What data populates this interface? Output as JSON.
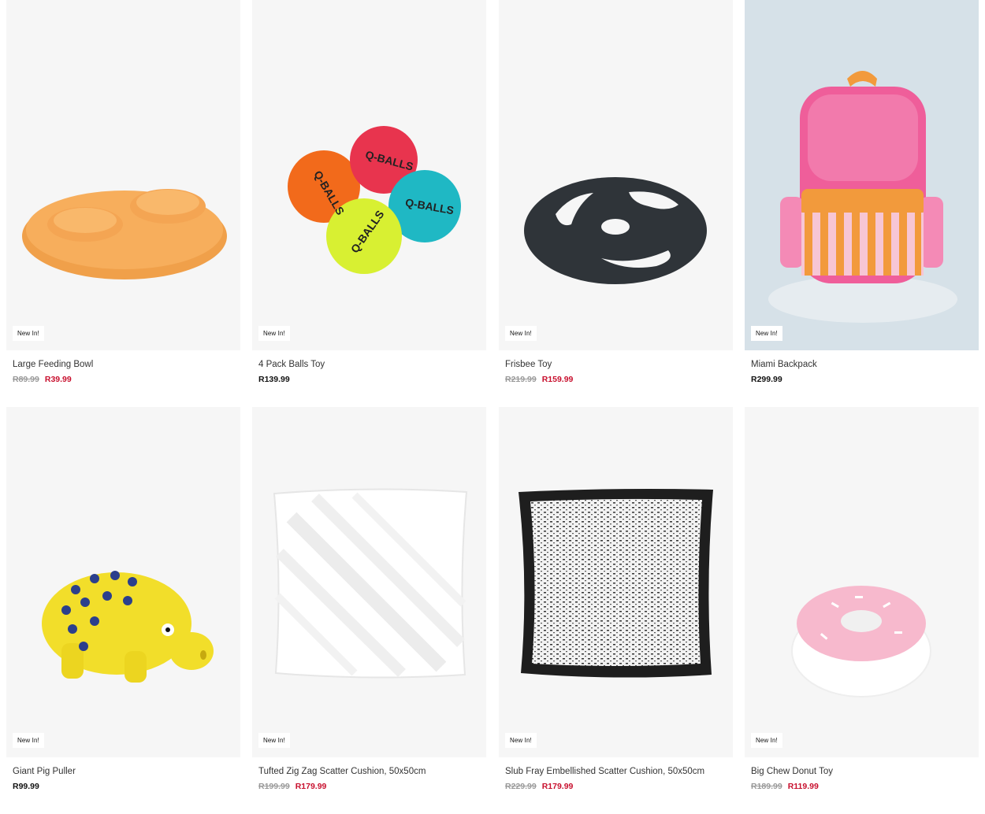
{
  "badge_label": "New In!",
  "products": [
    {
      "name": "Large Feeding Bowl",
      "was_price": "R89.99",
      "price": "R39.99",
      "on_sale": true
    },
    {
      "name": "4 Pack Balls Toy",
      "was_price": "",
      "price": "R139.99",
      "on_sale": false,
      "ball_text": "Q-BALLS"
    },
    {
      "name": "Frisbee Toy",
      "was_price": "R219.99",
      "price": "R159.99",
      "on_sale": true
    },
    {
      "name": "Miami Backpack",
      "was_price": "",
      "price": "R299.99",
      "on_sale": false
    },
    {
      "name": "Giant Pig Puller",
      "was_price": "",
      "price": "R99.99",
      "on_sale": false
    },
    {
      "name": "Tufted Zig Zag Scatter Cushion, 50x50cm",
      "was_price": "R199.99",
      "price": "R179.99",
      "on_sale": true
    },
    {
      "name": "Slub Fray Embellished Scatter Cushion, 50x50cm",
      "was_price": "R229.99",
      "price": "R179.99",
      "on_sale": true
    },
    {
      "name": "Big Chew Donut Toy",
      "was_price": "R189.99",
      "price": "R119.99",
      "on_sale": true
    }
  ],
  "colors": {
    "sale": "#c8102e",
    "strike": "#999999",
    "tile_bg": "#f6f6f6"
  }
}
